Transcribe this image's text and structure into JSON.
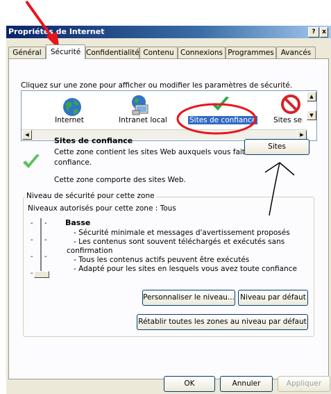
{
  "window": {
    "title": "Propriétés de Internet",
    "help_label": "?",
    "close_label": "x"
  },
  "tabs": [
    {
      "label": "Général"
    },
    {
      "label": "Sécurité"
    },
    {
      "label": "Confidentialité"
    },
    {
      "label": "Contenu"
    },
    {
      "label": "Connexions"
    },
    {
      "label": "Programmes"
    },
    {
      "label": "Avancés"
    }
  ],
  "active_tab": "Sécurité",
  "zone_prompt": "Cliquez sur une zone pour afficher ou modifier les paramètres de sécurité.",
  "zones": [
    {
      "label": "Internet",
      "icon": "globe-icon"
    },
    {
      "label": "Intranet local",
      "icon": "intranet-icon"
    },
    {
      "label": "Sites de confiance",
      "icon": "checkmark-icon",
      "selected": true
    },
    {
      "label": "Sites sen",
      "icon": "restricted-icon"
    }
  ],
  "selected_zone": {
    "title": "Sites de confiance",
    "description": "Cette zone contient les sites Web auxquels vous faites confiance.",
    "description_line1": "Cette zone contient les sites Web auxquels vous faites",
    "description_line2": "confiance.",
    "status": "Cette zone comporte des sites Web.",
    "sites_button": "Sites"
  },
  "security_level": {
    "group_label": "Niveau de sécurité pour cette zone",
    "allowed": "Niveaux autorisés pour cette zone : Tous",
    "level_name": "Basse",
    "bullets": [
      "- Sécurité minimale et messages d'avertissement proposés",
      "- Les contenus sont souvent téléchargés et exécutés sans",
      "confirmation",
      "- Tous les contenus actifs peuvent être exécutés",
      "- Adapté pour les sites en lesquels vous avez toute confiance"
    ],
    "customize_button": "Personnaliser le niveau...",
    "default_button": "Niveau par défaut",
    "reset_all_button": "Rétablir toutes les zones au niveau par défaut"
  },
  "footer": {
    "ok": "OK",
    "cancel": "Annuler",
    "apply": "Appliquer"
  },
  "colors": {
    "annotation_red": "#e8141c",
    "annotation_black": "#000000",
    "selection_blue": "#316ac5"
  }
}
